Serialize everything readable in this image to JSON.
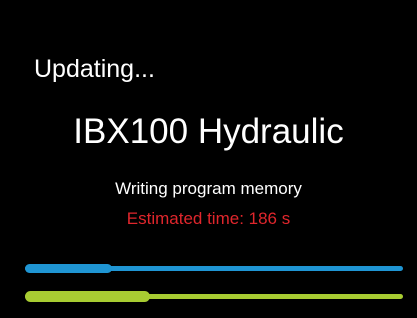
{
  "screen": {
    "status_heading": "Updating...",
    "device_name": "IBX100 Hydraulic",
    "step_text": "Writing program memory",
    "eta_text": "Estimated time: 186 s"
  },
  "progress": [
    {
      "name": "step-progress",
      "fraction": 0.23,
      "color": "#1f95d3"
    },
    {
      "name": "overall-progress",
      "fraction": 0.33,
      "color": "#a8cc32"
    }
  ],
  "colors": {
    "background": "#000000",
    "text": "#ffffff",
    "eta": "#e0262c"
  }
}
